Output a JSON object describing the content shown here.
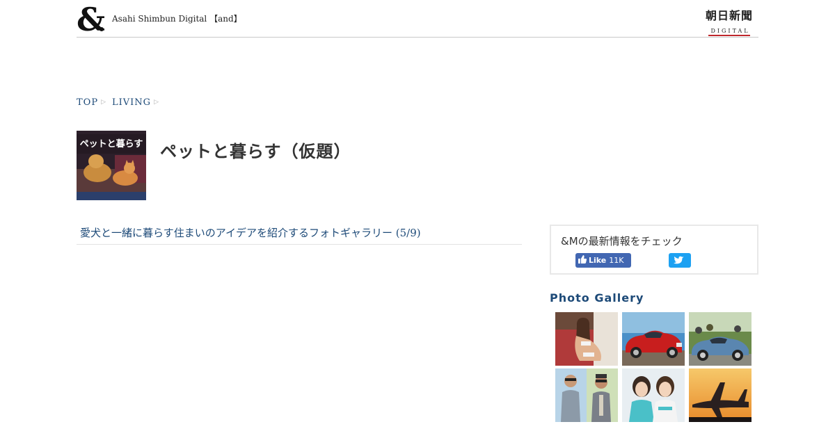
{
  "header": {
    "logo_icon": "ampersand-logo",
    "site_name": "Asahi Shimbun Digital",
    "site_bracket_text": "and",
    "brand_top": "朝日新聞",
    "brand_bottom": "DIGITAL"
  },
  "breadcrumb": {
    "items": [
      {
        "label": "TOP"
      },
      {
        "label": "LIVING"
      }
    ],
    "separator_icon": "chevron-right-icon"
  },
  "category": {
    "thumbnail_text": "ペットと暮らす",
    "title": "ペットと暮らす（仮題）"
  },
  "article": {
    "title": "愛犬と一緒に暮らす住まいのアイデアを紹介するフォトギャラリー",
    "counter": "(5/9)"
  },
  "social": {
    "title": "&Mの最新情報をチェック",
    "facebook": {
      "icon": "thumbs-up-icon",
      "label": "Like",
      "count": "11K"
    },
    "twitter": {
      "icon": "twitter-bird-icon"
    }
  },
  "gallery": {
    "heading": "Photo Gallery",
    "items": [
      {
        "subject": "model-photo"
      },
      {
        "subject": "red-classic-car"
      },
      {
        "subject": "blue-classic-car"
      },
      {
        "subject": "street-fashion"
      },
      {
        "subject": "race-queens"
      },
      {
        "subject": "airplane-sunset"
      }
    ]
  },
  "colors": {
    "link": "#1d4a78",
    "facebook": "#4267b2",
    "twitter": "#1da1f2",
    "brand_accent": "#c0282d"
  }
}
